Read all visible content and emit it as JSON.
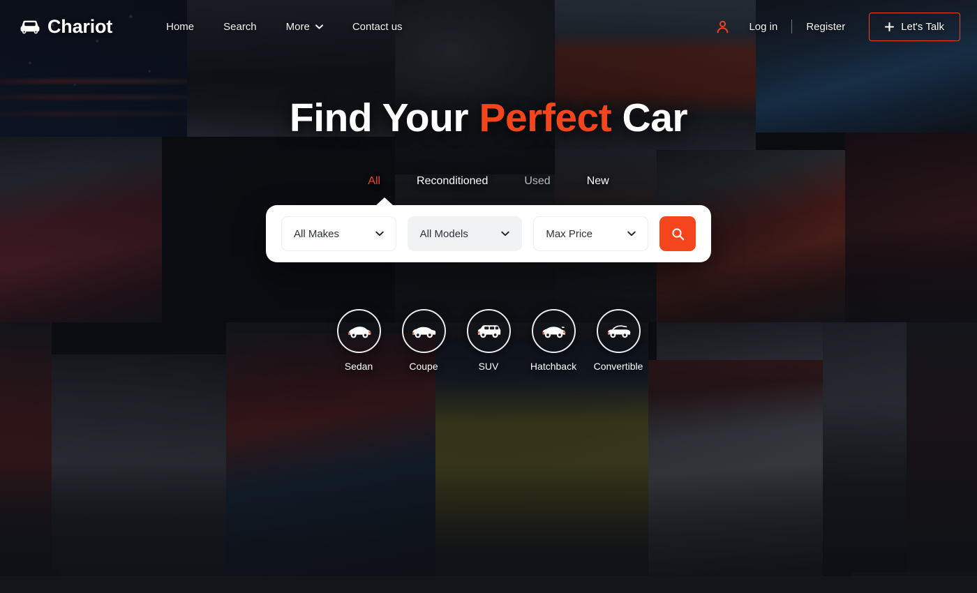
{
  "brand": {
    "name": "Chariot",
    "icon": "car-front-icon"
  },
  "nav": {
    "items": [
      {
        "label": "Home",
        "icon": null
      },
      {
        "label": "Search",
        "icon": null
      },
      {
        "label": "More",
        "icon": "chevron-down-icon"
      },
      {
        "label": "Contact us",
        "icon": null
      }
    ]
  },
  "header_right": {
    "user_icon": "user-icon",
    "login_label": "Log in",
    "register_label": "Register",
    "talk_label": "Let's Talk",
    "talk_icon": "plus-icon",
    "talk_border_color": "#f0451c"
  },
  "hero": {
    "title_part1": "Find Your ",
    "title_accent": "Perfect",
    "title_part2": " Car",
    "accent_color": "#f4451c"
  },
  "condition_tabs": {
    "items": [
      {
        "label": "All",
        "state": "active"
      },
      {
        "label": "Reconditioned",
        "state": "default"
      },
      {
        "label": "Used",
        "state": "dim"
      },
      {
        "label": "New",
        "state": "default"
      }
    ]
  },
  "search": {
    "fields": [
      {
        "label": "All Makes",
        "icon": "chevron-down-icon",
        "state": "default"
      },
      {
        "label": "All Models",
        "icon": "chevron-down-icon",
        "state": "hovered"
      },
      {
        "label": "Max Price",
        "icon": "chevron-down-icon",
        "state": "default"
      }
    ],
    "button_icon": "search-icon",
    "button_color": "#f4451c"
  },
  "categories": {
    "items": [
      {
        "label": "Sedan",
        "icon": "sedan-car-icon"
      },
      {
        "label": "Coupe",
        "icon": "coupe-car-icon"
      },
      {
        "label": "SUV",
        "icon": "suv-car-icon"
      },
      {
        "label": "Hatchback",
        "icon": "hatchback-car-icon"
      },
      {
        "label": "Convertible",
        "icon": "convertible-car-icon"
      }
    ]
  }
}
